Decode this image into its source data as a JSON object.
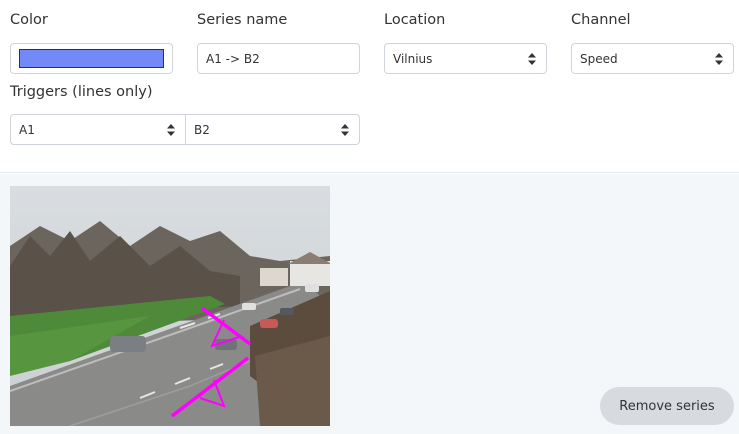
{
  "form": {
    "color_label": "Color",
    "color_value": "#7289f7",
    "series_name_label": "Series name",
    "series_name_value": "A1 -> B2",
    "location_label": "Location",
    "location_value": "Vilnius",
    "channel_label": "Channel",
    "channel_value": "Speed",
    "triggers_label": "Triggers (lines only)",
    "trigger_from": "A1",
    "trigger_to": "B2"
  },
  "preview": {
    "line_color": "#ff00ff",
    "remove_label": "Remove series"
  }
}
